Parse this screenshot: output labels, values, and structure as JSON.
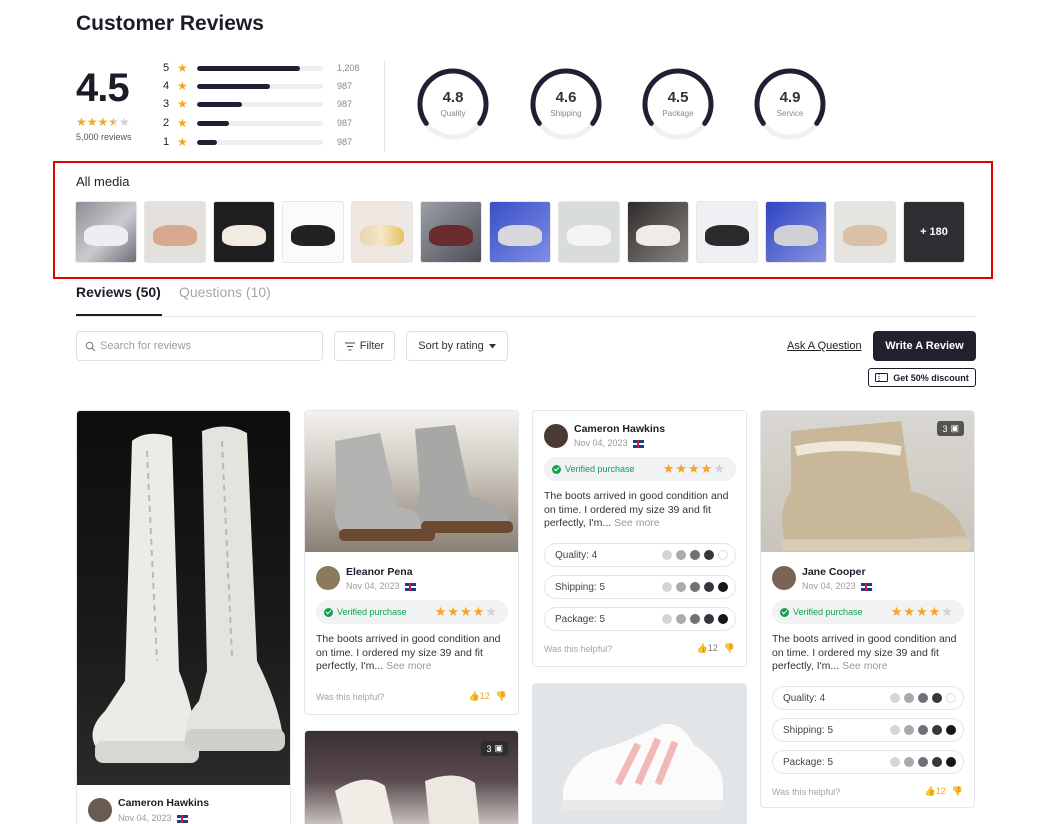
{
  "header": {
    "title": "Customer Reviews"
  },
  "summary": {
    "rating": "4.5",
    "stars": "★★★★☆",
    "count_text": "5,000 reviews",
    "distribution": [
      {
        "stars": "5",
        "count": "1,208",
        "fraction": 0.82
      },
      {
        "stars": "4",
        "count": "987",
        "fraction": 0.58
      },
      {
        "stars": "3",
        "count": "987",
        "fraction": 0.36
      },
      {
        "stars": "2",
        "count": "987",
        "fraction": 0.25
      },
      {
        "stars": "1",
        "count": "987",
        "fraction": 0.16
      }
    ]
  },
  "gauges": [
    {
      "value": "4.8",
      "label": "Quality"
    },
    {
      "value": "4.6",
      "label": "Shipping"
    },
    {
      "value": "4.5",
      "label": "Package"
    },
    {
      "value": "4.9",
      "label": "Service"
    }
  ],
  "media": {
    "title": "All media",
    "more_label": "+ 180"
  },
  "tabs": [
    {
      "label": "Reviews (50)"
    },
    {
      "label": "Questions (10)"
    }
  ],
  "toolbar": {
    "search_placeholder": "Search for reviews",
    "filter_label": "Filter",
    "sort_label": "Sort by rating",
    "ask_label": "Ask A Question",
    "write_label": "Write A Review",
    "discount_label": "Get 50% discount"
  },
  "reviews": {
    "card_a": {
      "name": "Cameron Hawkins",
      "date": "Nov 04, 2023"
    },
    "card_b": {
      "name": "Eleanor Pena",
      "date": "Nov 04, 2023",
      "verified": "Verified purchase",
      "text": "The boots arrived in good condition and on time. I ordered my size 39 and fit perfectly, I'm...",
      "see_more": "See more",
      "helpful": "Was this helpful?",
      "likes": "12"
    },
    "card_b2": {
      "badge": "3"
    },
    "card_c": {
      "name": "Cameron Hawkins",
      "date": "Nov 04, 2023",
      "verified": "Verified purchase",
      "text": "The boots arrived in good condition and on time. I ordered my size 39 and fit perfectly, I'm...",
      "see_more": "See more",
      "helpful": "Was this helpful?",
      "likes": "12",
      "aspects": [
        {
          "label": "Quality: 4"
        },
        {
          "label": "Shipping: 5"
        },
        {
          "label": "Package: 5"
        }
      ]
    },
    "card_d": {
      "badge": "3",
      "name": "Jane Cooper",
      "date": "Nov 04, 2023",
      "verified": "Verified purchase",
      "text": "The boots arrived in good condition and on time. I ordered my size 39 and fit perfectly, I'm...",
      "see_more": "See more",
      "helpful": "Was this helpful?",
      "likes": "12",
      "aspects": [
        {
          "label": "Quality: 4"
        },
        {
          "label": "Shipping: 5"
        },
        {
          "label": "Package: 5"
        }
      ]
    }
  },
  "colors": {
    "accent": "#22222e",
    "star": "#f5a524",
    "verified": "#12a150",
    "highlight_box": "#e00000"
  }
}
